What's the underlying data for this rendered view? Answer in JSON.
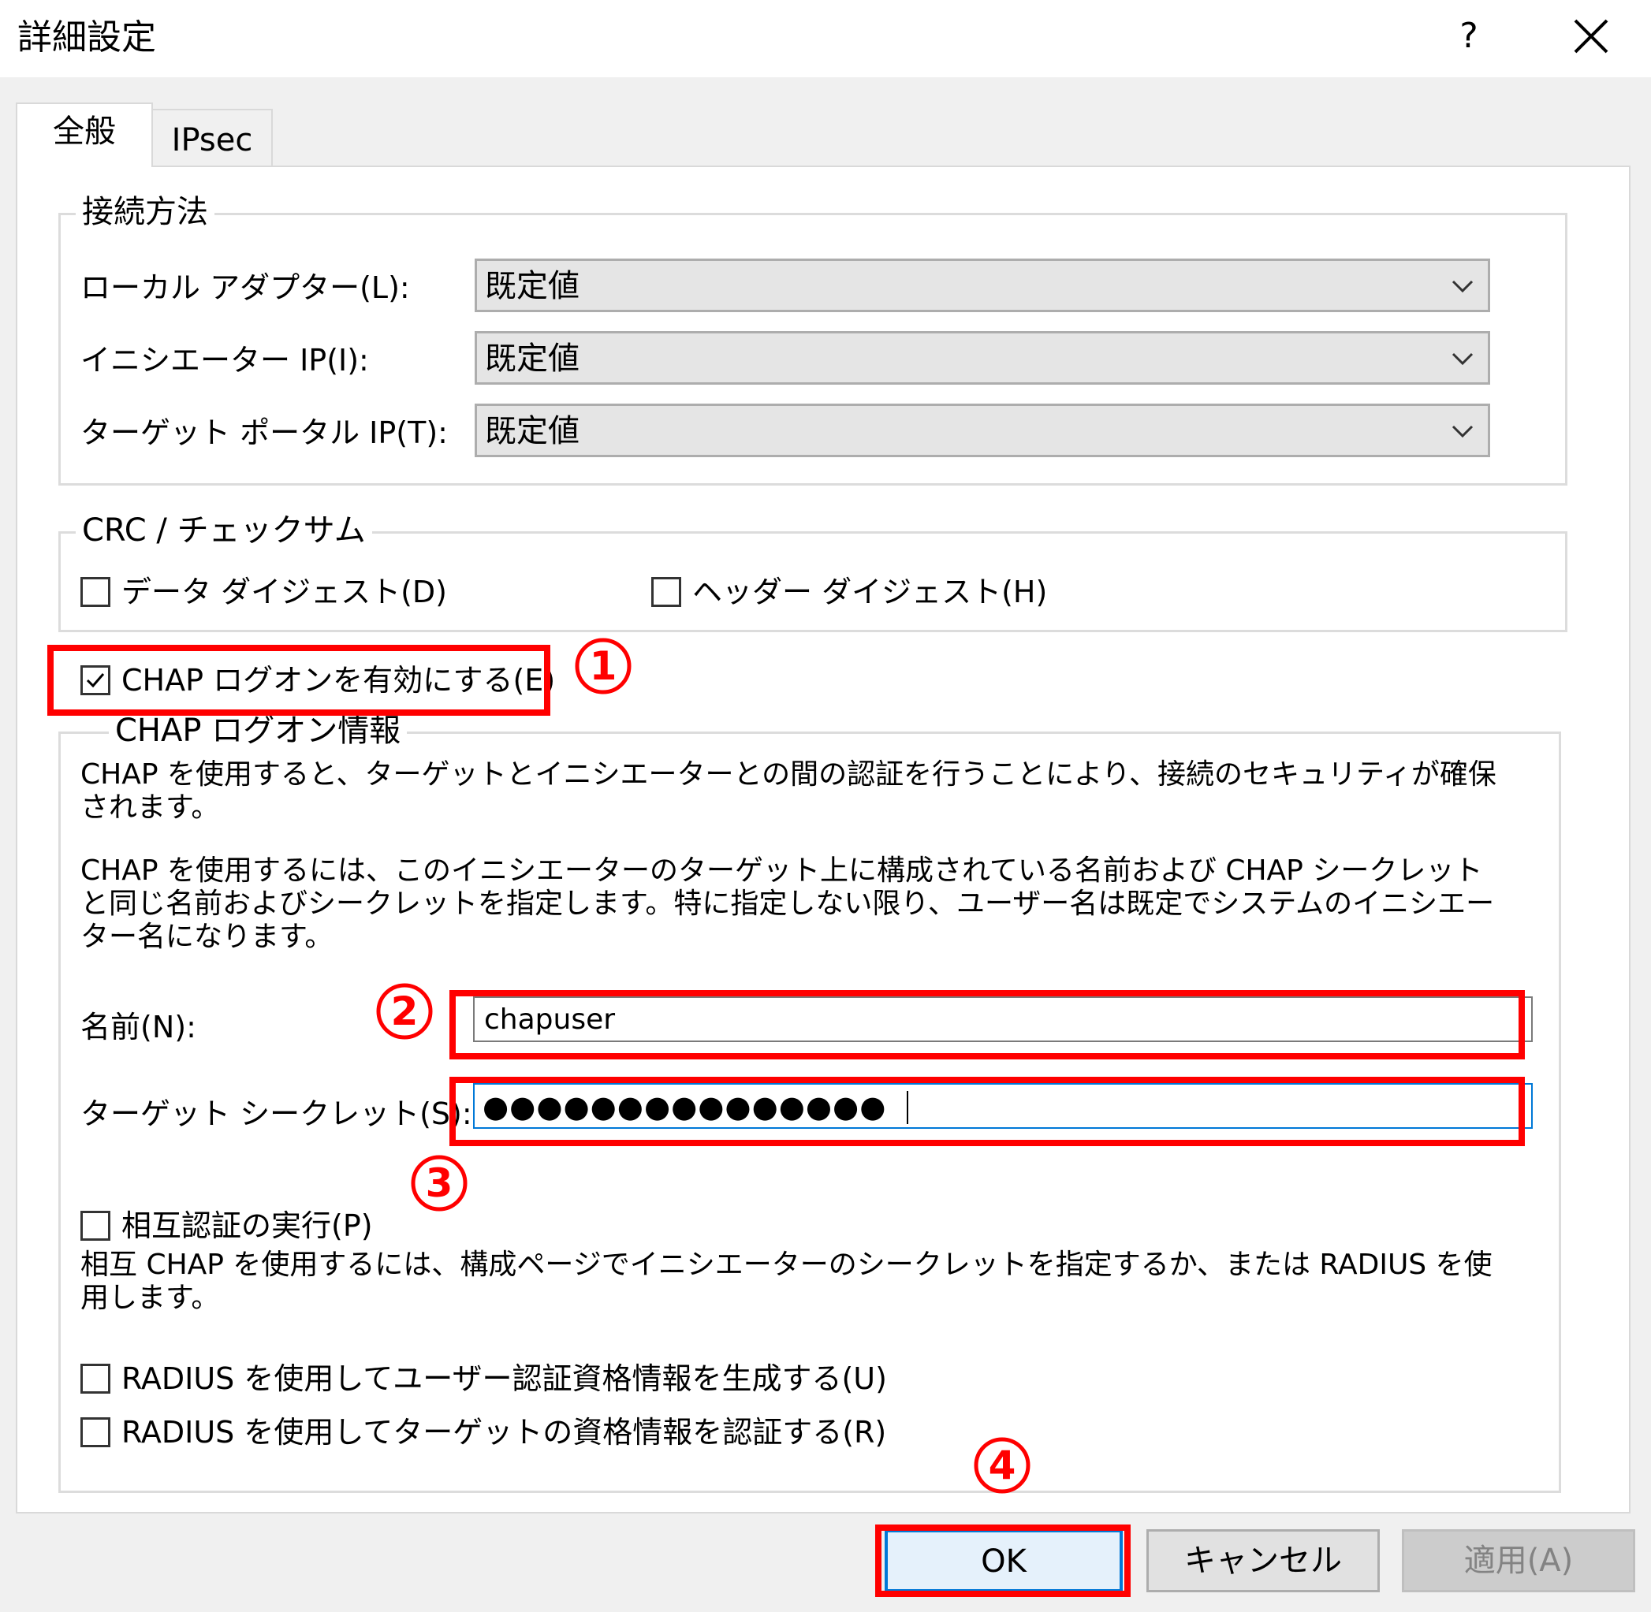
{
  "window": {
    "title": "詳細設定",
    "help_label": "?",
    "close_icon": "close-icon"
  },
  "tabs": [
    {
      "label": "全般",
      "active": true
    },
    {
      "label": "IPsec",
      "active": false
    }
  ],
  "connection": {
    "group_label": "接続方法",
    "local_adapter_label": "ローカル アダプター(L):",
    "local_adapter_value": "既定値",
    "initiator_ip_label": "イニシエーター IP(I):",
    "initiator_ip_value": "既定値",
    "target_portal_label": "ターゲット ポータル IP(T):",
    "target_portal_value": "既定値"
  },
  "crc": {
    "group_label": "CRC / チェックサム",
    "data_digest_label": "データ ダイジェスト(D)",
    "data_digest_checked": false,
    "header_digest_label": "ヘッダー ダイジェスト(H)",
    "header_digest_checked": false
  },
  "chap": {
    "enable_label": "CHAP ログオンを有効にする(E)",
    "enable_checked": true,
    "group_label": "CHAP ログオン情報",
    "desc1": "CHAP を使用すると、ターゲットとイニシエーターとの間の認証を行うことにより、接続のセキュリティが確保されます。",
    "desc2": "CHAP を使用するには、このイニシエーターのターゲット上に構成されている名前および CHAP シークレットと同じ名前およびシークレットを指定します。特に指定しない限り、ユーザー名は既定でシステムのイニシエーター名になります。",
    "name_label": "名前(N):",
    "name_value": "chapuser",
    "secret_label": "ターゲット シークレット(S):",
    "secret_value": "●●●●●●●●●●●●●●●",
    "mutual_label": "相互認証の実行(P)",
    "mutual_checked": false,
    "mutual_desc": "相互 CHAP を使用するには、構成ページでイニシエーターのシークレットを指定するか、または RADIUS を使用します。",
    "radius_user_label": "RADIUS を使用してユーザー認証資格情報を生成する(U)",
    "radius_user_checked": false,
    "radius_target_label": "RADIUS を使用してターゲットの資格情報を認証する(R)",
    "radius_target_checked": false
  },
  "annotations": {
    "step1": "1",
    "step2": "2",
    "step3": "3",
    "step4": "4",
    "color": "#ff0000"
  },
  "buttons": {
    "ok": "OK",
    "cancel": "キャンセル",
    "apply": "適用(A)",
    "apply_enabled": false
  }
}
